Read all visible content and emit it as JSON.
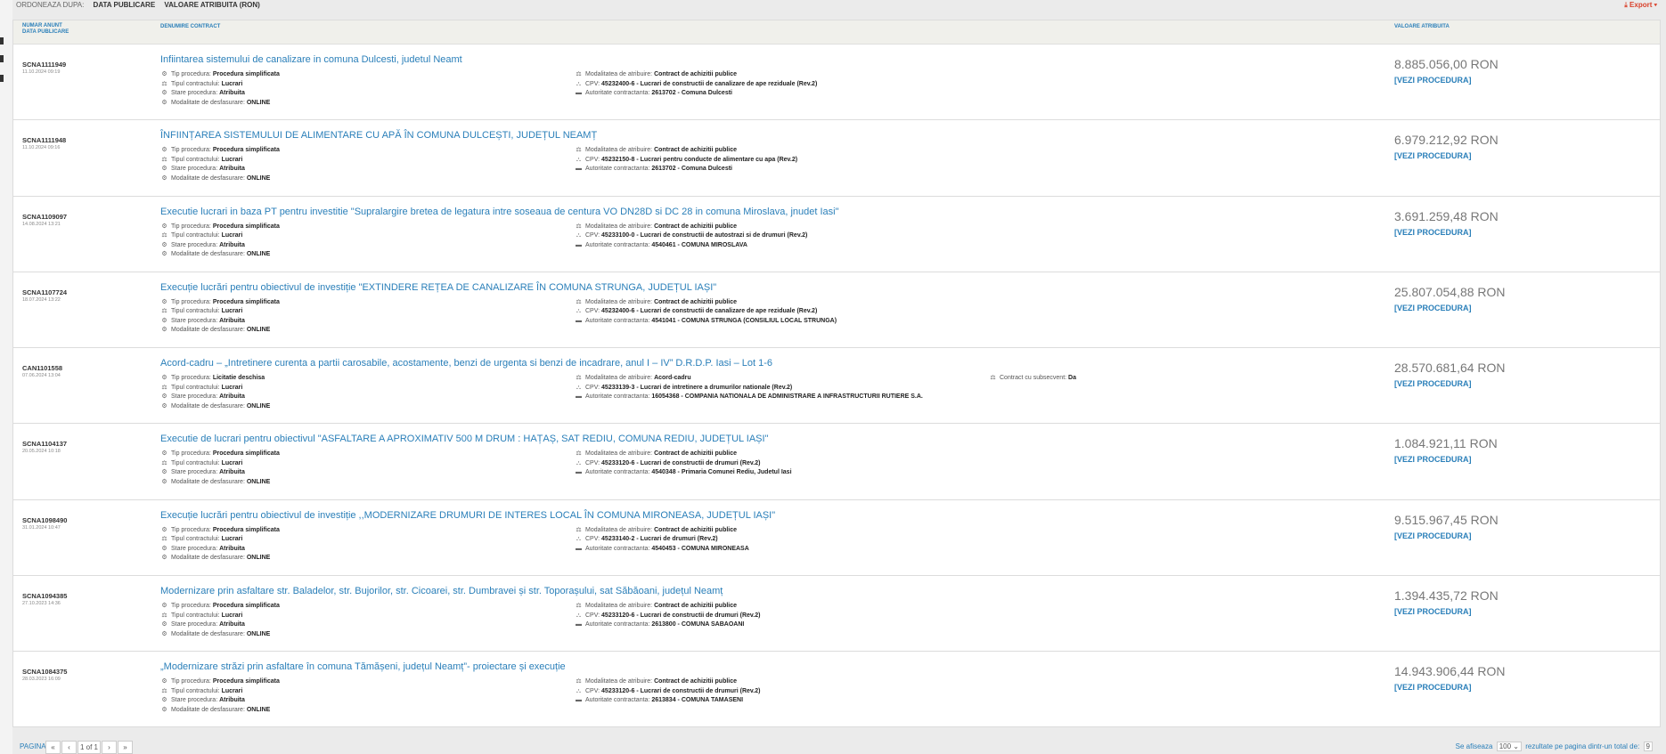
{
  "sort": {
    "label": "ORDONEAZA DUPA:",
    "options": [
      "DATA PUBLICARE",
      "VALOARE ATRIBUITA (RON)"
    ]
  },
  "export_label": "Export",
  "columns": {
    "num": "NUMAR ANUNT",
    "date": "DATA PUBLICARE",
    "name": "DENUMIRE CONTRACT",
    "value": "VALOARE ATRIBUITA"
  },
  "field_labels": {
    "tip": "Tip procedura:",
    "tipul": "Tipul contractului:",
    "stare": "Stare procedura:",
    "mod": "Modalitate de desfasurare:",
    "atrib": "Modalitatea de atribuire:",
    "cpv": "CPV:",
    "auth": "Autoritate contractanta:",
    "subsec": "Contract cu subsecvent:"
  },
  "icons": {
    "procedure": "cogs-icon",
    "contract_type": "balance-scale-icon",
    "status": "cogs-icon",
    "mode": "cogs-icon",
    "award": "balance-scale-icon",
    "cpv": "sitemap-icon",
    "authority": "briefcase-icon",
    "export": "download-icon"
  },
  "link_label": "[VEZI PROCEDURA]",
  "rows": [
    {
      "num": "SCNA1111949",
      "date": "11.10.2024 09:19",
      "title": "Infiintarea sistemului de canalizare in comuna Dulcesti, judetul Neamt",
      "tip": "Procedura simplificata",
      "tipul": "Lucrari",
      "stare": "Atribuita",
      "mod": "ONLINE",
      "atrib": "Contract de achizitii publice",
      "cpv": "45232400-6 - Lucrari de constructii de canalizare de ape reziduale (Rev.2)",
      "auth": "2613702 - Comuna Dulcesti",
      "value": "8.885.056,00  RON"
    },
    {
      "num": "SCNA1111948",
      "date": "11.10.2024 09:16",
      "title": "ÎNFIINȚAREA SISTEMULUI DE ALIMENTARE CU APĂ ÎN COMUNA DULCEȘTI, JUDEȚUL NEAMȚ",
      "tip": "Procedura simplificata",
      "tipul": "Lucrari",
      "stare": "Atribuita",
      "mod": "ONLINE",
      "atrib": "Contract de achizitii publice",
      "cpv": "45232150-8 - Lucrari pentru conducte de alimentare cu apa (Rev.2)",
      "auth": "2613702 - Comuna Dulcesti",
      "value": "6.979.212,92  RON"
    },
    {
      "num": "SCNA1109097",
      "date": "14.08.2024 13:21",
      "title": "Executie lucrari in baza PT pentru investitie \"Supralargire bretea de legatura intre soseaua de centura VO DN28D si DC 28 in comuna Miroslava, jnudet Iasi\"",
      "tip": "Procedura simplificata",
      "tipul": "Lucrari",
      "stare": "Atribuita",
      "mod": "ONLINE",
      "atrib": "Contract de achizitii publice",
      "cpv": "45233100-0 - Lucrari de constructii de autostrazi si de drumuri (Rev.2)",
      "auth": "4540461 - COMUNA MIROSLAVA",
      "value": "3.691.259,48  RON"
    },
    {
      "num": "SCNA1107724",
      "date": "18.07.2024 13:22",
      "title": "Execuție lucrări pentru obiectivul de investiție \"EXTINDERE REȚEA DE CANALIZARE ÎN COMUNA STRUNGA, JUDEȚUL IAȘI\"",
      "tip": "Procedura simplificata",
      "tipul": "Lucrari",
      "stare": "Atribuita",
      "mod": "ONLINE",
      "atrib": "Contract de achizitii publice",
      "cpv": "45232400-6 - Lucrari de constructii de canalizare de ape reziduale (Rev.2)",
      "auth": "4541041 - COMUNA STRUNGA (CONSILIUL LOCAL STRUNGA)",
      "value": "25.807.054,88  RON"
    },
    {
      "num": "CAN1101558",
      "date": "07.06.2024 13:04",
      "title": "Acord-cadru – „Intretinere curenta a partii carosabile, acostamente, benzi de urgenta si benzi de incadrare, anul I – IV” D.R.D.P. Iasi – Lot 1-6",
      "tip": "Licitatie deschisa",
      "tipul": "Lucrari",
      "stare": "Atribuita",
      "mod": "ONLINE",
      "atrib": "Acord-cadru",
      "cpv": "45233139-3 - Lucrari de intretinere a drumurilor nationale (Rev.2)",
      "auth": "16054368 - COMPANIA NATIONALA DE ADMINISTRARE A INFRASTRUCTURII RUTIERE S.A.",
      "subsec": "Da",
      "value": "28.570.681,64  RON"
    },
    {
      "num": "SCNA1104137",
      "date": "20.05.2024 10:18",
      "title": "Executie de lucrari pentru obiectivul \"ASFALTARE A APROXIMATIV 500 M DRUM : HAȚAȘ, SAT REDIU, COMUNA REDIU, JUDEȚUL IAȘI\"",
      "tip": "Procedura simplificata",
      "tipul": "Lucrari",
      "stare": "Atribuita",
      "mod": "ONLINE",
      "atrib": "Contract de achizitii publice",
      "cpv": "45233120-6 - Lucrari de constructii de drumuri (Rev.2)",
      "auth": "4540348 - Primaria Comunei Rediu, Judetul Iasi",
      "value": "1.084.921,11  RON"
    },
    {
      "num": "SCNA1098490",
      "date": "31.01.2024 10:47",
      "title": "Execuție lucrări pentru obiectivul de investiție ,,MODERNIZARE DRUMURI DE INTERES LOCAL ÎN COMUNA MIRONEASA, JUDEȚUL IAȘI\"",
      "tip": "Procedura simplificata",
      "tipul": "Lucrari",
      "stare": "Atribuita",
      "mod": "ONLINE",
      "atrib": "Contract de achizitii publice",
      "cpv": "45233140-2 - Lucrari de drumuri (Rev.2)",
      "auth": "4540453 - COMUNA MIRONEASA",
      "value": "9.515.967,45  RON"
    },
    {
      "num": "SCNA1094385",
      "date": "27.10.2023 14:36",
      "title": "Modernizare prin asfaltare str. Baladelor, str. Bujorilor, str. Cicoarei, str. Dumbravei și str. Toporașului, sat Săbăoani, județul Neamț",
      "tip": "Procedura simplificata",
      "tipul": "Lucrari",
      "stare": "Atribuita",
      "mod": "ONLINE",
      "atrib": "Contract de achizitii publice",
      "cpv": "45233120-6 - Lucrari de constructii de drumuri (Rev.2)",
      "auth": "2613800 - COMUNA SABAOANI",
      "value": "1.394.435,72  RON"
    },
    {
      "num": "SCNA1084375",
      "date": "28.03.2023 16:09",
      "title": "„Modernizare străzi prin asfaltare în comuna Tămășeni, județul Neamț”- proiectare și execuție",
      "tip": "Procedura simplificata",
      "tipul": "Lucrari",
      "stare": "Atribuita",
      "mod": "ONLINE",
      "atrib": "Contract de achizitii publice",
      "cpv": "45233120-6 - Lucrari de constructii de drumuri (Rev.2)",
      "auth": "2613834 - COMUNA TAMASENI",
      "value": "14.943.906,44  RON"
    }
  ],
  "pagination": {
    "label": "PAGINA",
    "first": "«",
    "prev": "‹",
    "page_text": "1 of 1",
    "next": "›",
    "last": "»",
    "showing_label": "Se afiseaza",
    "page_size": "100",
    "per_page_text": "rezultate pe pagina dintr-un total de:",
    "total": "9"
  }
}
